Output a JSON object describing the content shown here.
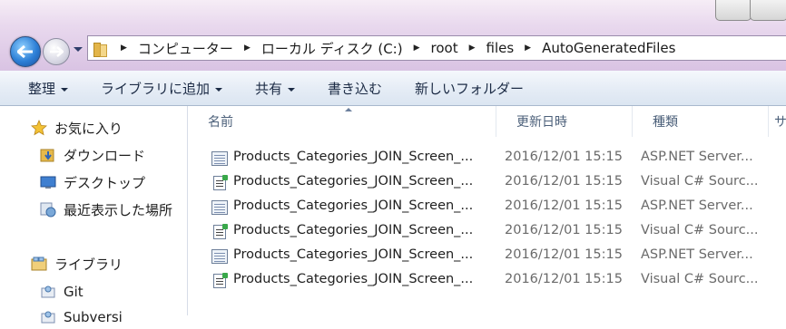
{
  "address": {
    "breadcrumbs": [
      "コンピューター",
      "ローカル ディスク (C:)",
      "root",
      "files",
      "AutoGeneratedFiles"
    ]
  },
  "toolbar": {
    "organize": "整理",
    "include_library": "ライブラリに追加",
    "share": "共有",
    "burn": "書き込む",
    "new_folder": "新しいフォルダー"
  },
  "nav": {
    "favorites": "お気に入り",
    "downloads": "ダウンロード",
    "desktop": "デスクトップ",
    "recent": "最近表示した場所",
    "libraries": "ライブラリ",
    "git": "Git",
    "partial": "Subversi"
  },
  "columns": {
    "name": "名前",
    "date": "更新日時",
    "type": "種類",
    "size": "サ"
  },
  "files": [
    {
      "name": "Products_Categories_JOIN_Screen_...",
      "date": "2016/12/01 15:15",
      "type": "ASP.NET Server...",
      "icon": "aspx-file-icon"
    },
    {
      "name": "Products_Categories_JOIN_Screen_...",
      "date": "2016/12/01 15:15",
      "type": "Visual C# Sourc...",
      "icon": "cs-file-icon"
    },
    {
      "name": "Products_Categories_JOIN_Screen_...",
      "date": "2016/12/01 15:15",
      "type": "ASP.NET Server...",
      "icon": "aspx-file-icon"
    },
    {
      "name": "Products_Categories_JOIN_Screen_...",
      "date": "2016/12/01 15:15",
      "type": "Visual C# Sourc...",
      "icon": "cs-file-icon"
    },
    {
      "name": "Products_Categories_JOIN_Screen_...",
      "date": "2016/12/01 15:15",
      "type": "ASP.NET Server...",
      "icon": "aspx-file-icon"
    },
    {
      "name": "Products_Categories_JOIN_Screen_...",
      "date": "2016/12/01 15:15",
      "type": "Visual C# Sourc...",
      "icon": "cs-file-icon"
    }
  ]
}
